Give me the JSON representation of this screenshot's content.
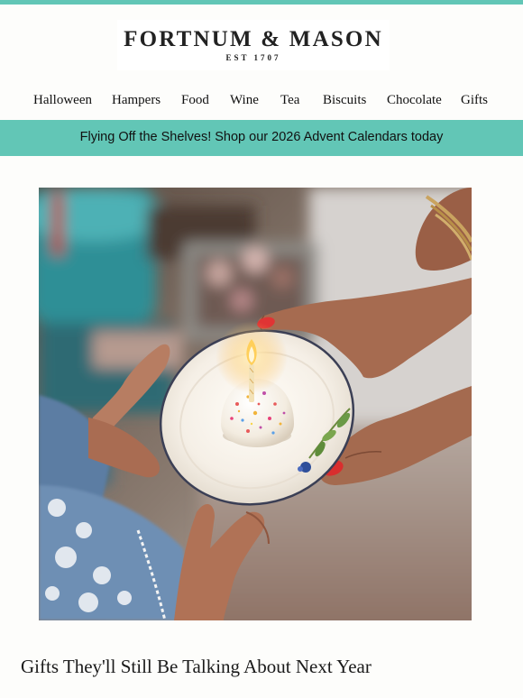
{
  "brand": {
    "name": "FORTNUM & MASON",
    "established": "EST 1707"
  },
  "nav": {
    "items": [
      "Halloween",
      "Hampers",
      "Food",
      "Wine",
      "Tea",
      "Biscuits",
      "Chocolate",
      "Gifts"
    ]
  },
  "banner": {
    "text": "Flying Off the Shelves! Shop our 2026 Advent Calendars today"
  },
  "hero": {
    "alt": "Gifts They'll Still Be Talking About Next Year"
  },
  "headline": {
    "text": "Gifts They'll Still Be Talking About Next Year"
  },
  "colors": {
    "accent": "#62c6b6",
    "background": "#fdfdfb",
    "text": "#1a1a1a"
  }
}
